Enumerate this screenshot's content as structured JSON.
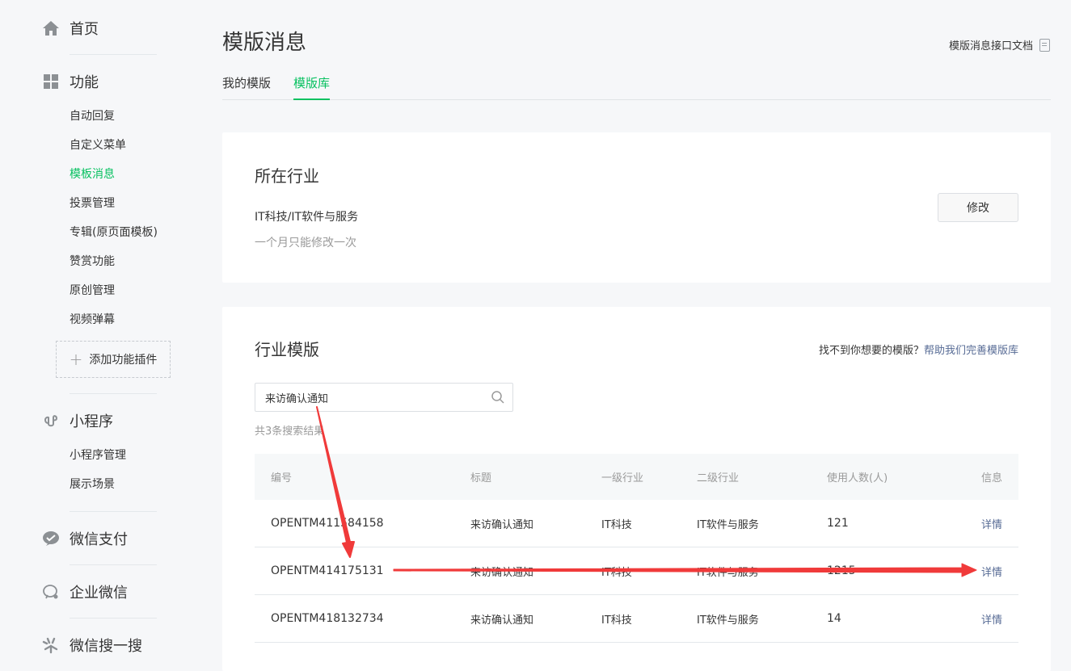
{
  "sidebar": {
    "home": "首页",
    "features": "功能",
    "feature_items": [
      "自动回复",
      "自定义菜单",
      "模板消息",
      "投票管理",
      "专辑(原页面模板)",
      "赞赏功能",
      "原创管理",
      "视频弹幕"
    ],
    "active_item": "模板消息",
    "add_plugin": "添加功能插件",
    "miniprogram": "小程序",
    "miniprogram_items": [
      "小程序管理",
      "展示场景"
    ],
    "wechat_pay": "微信支付",
    "work_wechat": "企业微信",
    "wechat_search": "微信搜一搜"
  },
  "header": {
    "title": "模版消息",
    "doc_link": "模版消息接口文档"
  },
  "tabs": [
    "我的模版",
    "模版库"
  ],
  "active_tab": "模版库",
  "industry_card": {
    "title": "所在行业",
    "industry": "IT科技/IT软件与服务",
    "note": "一个月只能修改一次",
    "modify_button": "修改"
  },
  "templates_card": {
    "title": "行业模版",
    "help_text": "找不到你想要的模版？",
    "help_link": "帮助我们完善模版库",
    "search_value": "来访确认通知",
    "result_count": "共3条搜索结果",
    "columns": [
      "编号",
      "标题",
      "一级行业",
      "二级行业",
      "使用人数(人)",
      "信息"
    ],
    "rows": [
      {
        "id": "OPENTM411584158",
        "title": "来访确认通知",
        "industry1": "IT科技",
        "industry2": "IT软件与服务",
        "users": "121",
        "info": "详情"
      },
      {
        "id": "OPENTM414175131",
        "title": "来访确认通知",
        "industry1": "IT科技",
        "industry2": "IT软件与服务",
        "users": "1215",
        "info": "详情"
      },
      {
        "id": "OPENTM418132734",
        "title": "来访确认通知",
        "industry1": "IT科技",
        "industry2": "IT软件与服务",
        "users": "14",
        "info": "详情"
      }
    ]
  },
  "colors": {
    "accent_green": "#07c160",
    "link_blue": "#576b95",
    "annotation_red": "#f03a3a"
  }
}
